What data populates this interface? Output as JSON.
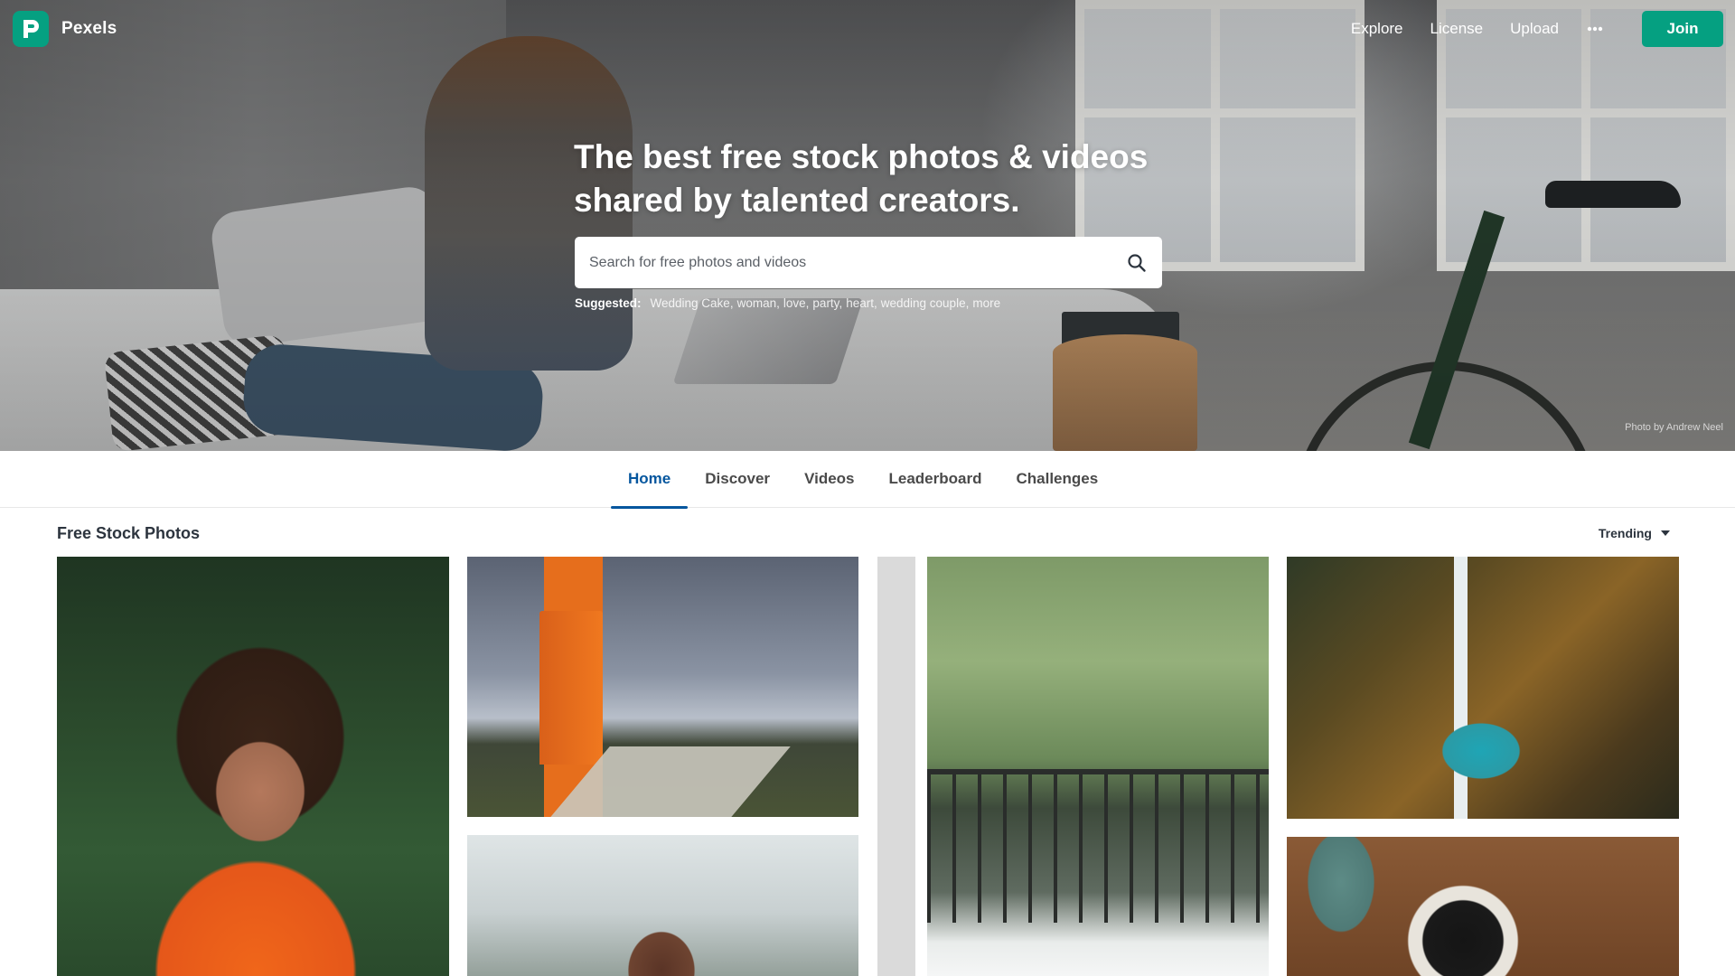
{
  "brand": {
    "name": "Pexels",
    "color": "#05a081"
  },
  "nav": {
    "links": [
      "Explore",
      "License",
      "Upload"
    ],
    "more_icon": "more-horizontal-icon",
    "join_label": "Join"
  },
  "hero": {
    "title": "The best free stock photos & videos shared by talented creators.",
    "search_placeholder": "Search for free photos and videos",
    "search_icon": "search-icon",
    "suggested_label": "Suggested:",
    "suggested": [
      "Wedding Cake",
      "woman",
      "love",
      "party",
      "heart",
      "wedding couple",
      "more"
    ],
    "photo_credit": "Photo by Andrew Neel"
  },
  "tabs": [
    {
      "label": "Home",
      "active": true
    },
    {
      "label": "Discover",
      "active": false
    },
    {
      "label": "Videos",
      "active": false
    },
    {
      "label": "Leaderboard",
      "active": false
    },
    {
      "label": "Challenges",
      "active": false
    }
  ],
  "gallery": {
    "title": "Free Stock Photos",
    "sort_label": "Trending",
    "active_color": "#05569e"
  }
}
